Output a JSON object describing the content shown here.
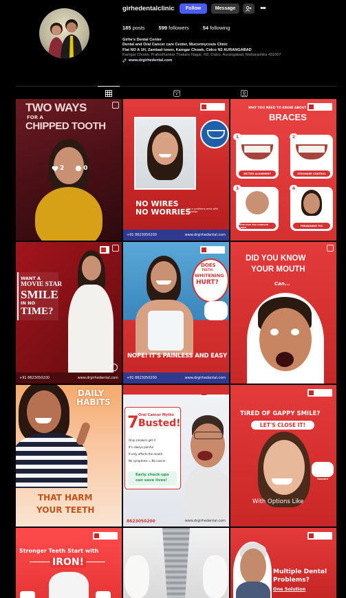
{
  "profile": {
    "username": "girhedentalclinic",
    "follow_label": "Follow",
    "message_label": "Message",
    "add_user_icon": "add-user-icon",
    "more_icon": "more-options-icon",
    "posts_count": "185",
    "posts_label": "posts",
    "followers_count": "599",
    "followers_label": "followers",
    "following_count": "54",
    "following_label": "following",
    "bio_name": "Girhe's Dental Center",
    "bio_line1": "Dental and Oral Cancer care Center, Mucormycosis Clinic",
    "bio_line2": "Flat NO A 1H, Zambad tower, Kamgar Chowk, Cidco N2 AURANGABAD",
    "bio_address": "Kamgar Chowk, Prabodhankar Thakare Nagar, N2, Cidco, Aurangabad, Maharashtra 431007",
    "bio_link": "www.drgirhedental.com"
  },
  "tabs": [
    {
      "name": "posts",
      "icon": "grid-icon",
      "active": true
    },
    {
      "name": "reels",
      "icon": "reels-icon",
      "active": false
    },
    {
      "name": "tagged",
      "icon": "tagged-icon",
      "active": false
    }
  ],
  "posts": {
    "p1": {
      "title1": "TWO WAYS",
      "title2": "FOR A",
      "title3": "CHIPPED TOOTH",
      "likes": "2",
      "comments": "0"
    },
    "p2": {
      "title1": "NO WIRES",
      "title2": "NO WORRIES",
      "sub": "Get a confident smile with invisalign",
      "phone": "+91 8623050200",
      "web": "www.drgirhedental.com"
    },
    "p3": {
      "top": "WHY YOU NEED TO KNOW ABOUT",
      "title": "BRACES",
      "n1": "1",
      "n2": "2",
      "n3": "3",
      "n4": "4",
      "c1": "BETTER ALIGNMENT",
      "c2": "STRONGER CONTROL",
      "c3": "EFFECTIVE FOR COMPLEX CASES",
      "c4": "PERMANENT FIX"
    },
    "p4": {
      "l1": "WANT A",
      "l2": "MOVIE STAR",
      "l3": "SMILE",
      "l4": "IN NO",
      "l5": "TIME?",
      "phone": "+91 8623050200",
      "web": "www.drgirhedental.com"
    },
    "p5": {
      "b1": "DOES",
      "b2": "TEETH",
      "b3": "WHITENING",
      "b4": "HURT?",
      "footer": "NOPE! IT'S PAINLESS AND EASY",
      "phone": "+91 8623050200",
      "web": "www.drgirhedental.com"
    },
    "p6": {
      "l1": "DID YOU KNOW",
      "l2": "YOUR MOUTH",
      "l3": "Can..."
    },
    "p7": {
      "top1": "DAILY",
      "top2": "HABITS",
      "bot1": "THAT HARM",
      "bot2": "YOUR TEETH"
    },
    "p8": {
      "num": "7",
      "t1": "Oral Cancer Myths",
      "t2": "Busted!",
      "m1": "Only smokers get it",
      "m2": "It's always painful",
      "m3": "It only affects the mouth",
      "m4": "No symptoms = No cancer",
      "cta1": "Early check-ups",
      "cta2": "can save lives!",
      "phone": "8623050200",
      "web": "www.drgirhedental.com"
    },
    "p9": {
      "l1": "TIRED OF GAPPY SMILE?",
      "l2": "LET'S CLOSE IT!",
      "l3": "With Options Like",
      "tag": "Veneers"
    },
    "p10": {
      "l1": "Stronger Teeth Start with",
      "l2": "IRON!"
    },
    "p12": {
      "l1": "Multiple Dental",
      "l2": "Problems?",
      "l3": "One Solution"
    }
  },
  "colors": {
    "accent": "#4a5df9",
    "brand_red": "#d62e2e",
    "text_muted": "#a8a8a8"
  }
}
